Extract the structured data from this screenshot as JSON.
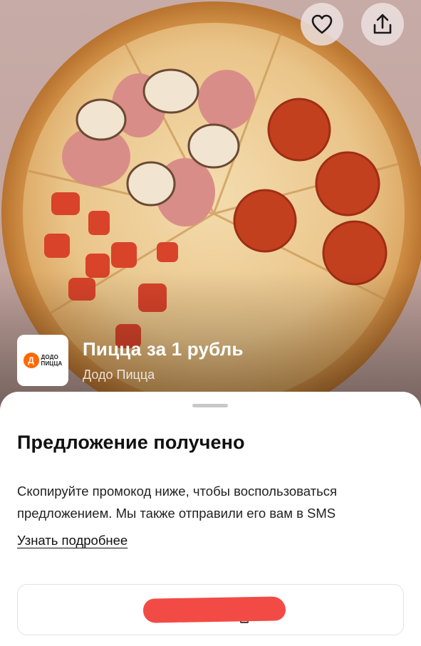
{
  "hero": {
    "favorite_icon": "heart-icon",
    "share_icon": "share-upload-icon",
    "offer_title": "Пицца за 1 рубль",
    "merchant_name": "Додо Пицца",
    "logo": {
      "text_line1": "ДОДО",
      "text_line2": "ПИЦЦА",
      "mark": "Д",
      "accent": "#ff6900"
    }
  },
  "sheet": {
    "title": "Предложение получено",
    "description": "Скопируйте промокод ниже, чтобы воспользоваться предложением. Мы также отправили его вам в SMS",
    "more_link": "Узнать подробнее",
    "promo_code": "",
    "promo_redacted": true,
    "redaction_color": "#f24b45"
  }
}
